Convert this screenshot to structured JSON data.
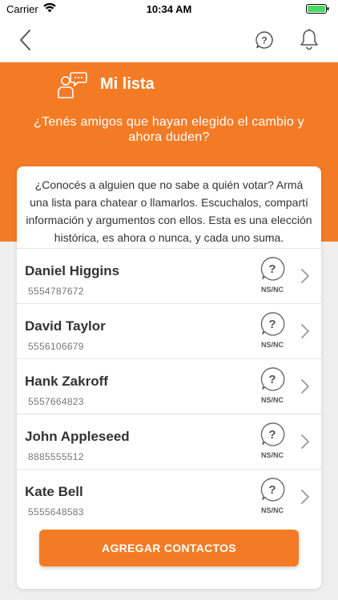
{
  "status_bar": {
    "carrier": "Carrier",
    "time": "10:34 AM"
  },
  "nav": {
    "back_icon": "chevron-left-icon",
    "help_icon": "question-circle-icon",
    "bell_icon": "bell-icon"
  },
  "header": {
    "title": "Mi lista",
    "subtitle": "¿Tenés amigos que hayan elegido el cambio y ahora duden?"
  },
  "card": {
    "intro": "¿Conocés a alguien que no sabe a quién votar? Armá una lista para chatear o llamarlos. Escuchalos, compartí información y argumentos con ellos. Esta es una elección histórica, es ahora o nunca, y cada uno suma.",
    "contacts": [
      {
        "name": "Daniel Higgins",
        "phone": "5554787672",
        "status": "NS/NC"
      },
      {
        "name": "David Taylor",
        "phone": "5556106679",
        "status": "NS/NC"
      },
      {
        "name": "Hank Zakroff",
        "phone": "5557664823",
        "status": "NS/NC"
      },
      {
        "name": "John Appleseed",
        "phone": "8885555512",
        "status": "NS/NC"
      },
      {
        "name": "Kate Bell",
        "phone": "5555648583",
        "status": "NS/NC"
      }
    ],
    "add_button": "AGREGAR CONTACTOS"
  },
  "colors": {
    "accent": "#f47b26",
    "background": "#efefef"
  }
}
